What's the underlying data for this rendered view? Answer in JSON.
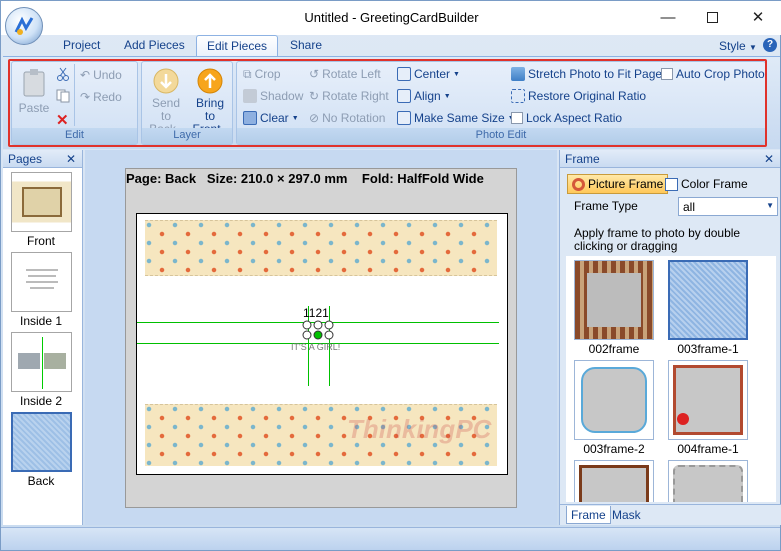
{
  "window": {
    "title": "Untitled - GreetingCardBuilder"
  },
  "tabs": [
    {
      "label": "Project"
    },
    {
      "label": "Add Pieces"
    },
    {
      "label": "Edit Pieces"
    },
    {
      "label": "Share"
    }
  ],
  "style_menu": "Style",
  "ribbon": {
    "edit_group": {
      "label": "Edit",
      "paste": "Paste",
      "undo": "Undo",
      "redo": "Redo"
    },
    "layer_group": {
      "label": "Layer",
      "send_to_back_1": "Send to",
      "send_to_back_2": "Back",
      "bring_to_front_1": "Bring to",
      "bring_to_front_2": "Front"
    },
    "photo_edit_group": {
      "label": "Photo Edit",
      "crop": "Crop",
      "shadow": "Shadow",
      "clear": "Clear",
      "rotate_left": "Rotate Left",
      "rotate_right": "Rotate Right",
      "no_rotation": "No Rotation",
      "center": "Center",
      "align": "Align",
      "make_same_size": "Make Same Size",
      "stretch": "Stretch  Photo to Fit Page",
      "restore_ratio": "Restore Original Ratio",
      "lock_aspect": "Lock Aspect Ratio",
      "auto_crop": "Auto Crop Photo"
    }
  },
  "pages_panel": {
    "title": "Pages",
    "pages": [
      {
        "label": "Front"
      },
      {
        "label": "Inside 1"
      },
      {
        "label": "Inside 2"
      },
      {
        "label": "Back"
      }
    ]
  },
  "canvas": {
    "info": "Page: Back   Size: 210.0 × 297.0 mm    Fold: HalfFold Wide",
    "number_text": "1121",
    "caption_text": "IT'S A GIRL!",
    "watermark": "ThinkingPC"
  },
  "frame_panel": {
    "title": "Frame",
    "picture_frame": "Picture Frame",
    "color_frame": "Color Frame",
    "frame_type_label": "Frame Type",
    "frame_type_value": "all",
    "hint": "Apply frame to photo by double clicking or dragging",
    "frames": [
      {
        "label": "002frame"
      },
      {
        "label": "003frame-1"
      },
      {
        "label": "003frame-2"
      },
      {
        "label": "004frame-1"
      }
    ],
    "bottom_tabs": [
      {
        "label": "Frame"
      },
      {
        "label": "Mask"
      }
    ]
  },
  "colors": {
    "accent": "#e0322b",
    "ribbon_bg": "#c7d9f0",
    "selection": "#00c000"
  }
}
